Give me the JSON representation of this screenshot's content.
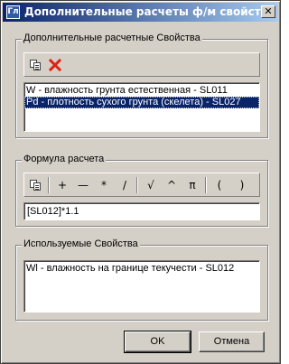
{
  "window": {
    "title": "Дополнительные расчеты ф/м свойств",
    "app_icon_text": "Гл",
    "close_glyph": "✕"
  },
  "extra_props": {
    "group_label": "Дополнительные расчетные Свойства",
    "items": [
      {
        "label": "W - влажность грунта естественная - SL011",
        "selected": false
      },
      {
        "label": "Pd - плотность сухого грунта (скелета) - SL027",
        "selected": true
      }
    ]
  },
  "formula": {
    "group_label": "Формула расчета",
    "toolbar": {
      "plus": "+",
      "minus": "—",
      "multiply": "*",
      "divide": "/",
      "sqrt": "√",
      "power": "^",
      "pi": "π",
      "lparen": "(",
      "rparen": ")"
    },
    "value": "[SL012]*1.1"
  },
  "used_props": {
    "group_label": "Используемые Свойства",
    "items": [
      {
        "label": "Wl - влажность на границе текучести - SL012"
      }
    ]
  },
  "buttons": {
    "ok": "OK",
    "cancel": "Отмена"
  },
  "colors": {
    "title_start": "#0a246a",
    "title_end": "#a6caf0",
    "delete_icon": "#e02010",
    "selection": "#0a246a"
  }
}
